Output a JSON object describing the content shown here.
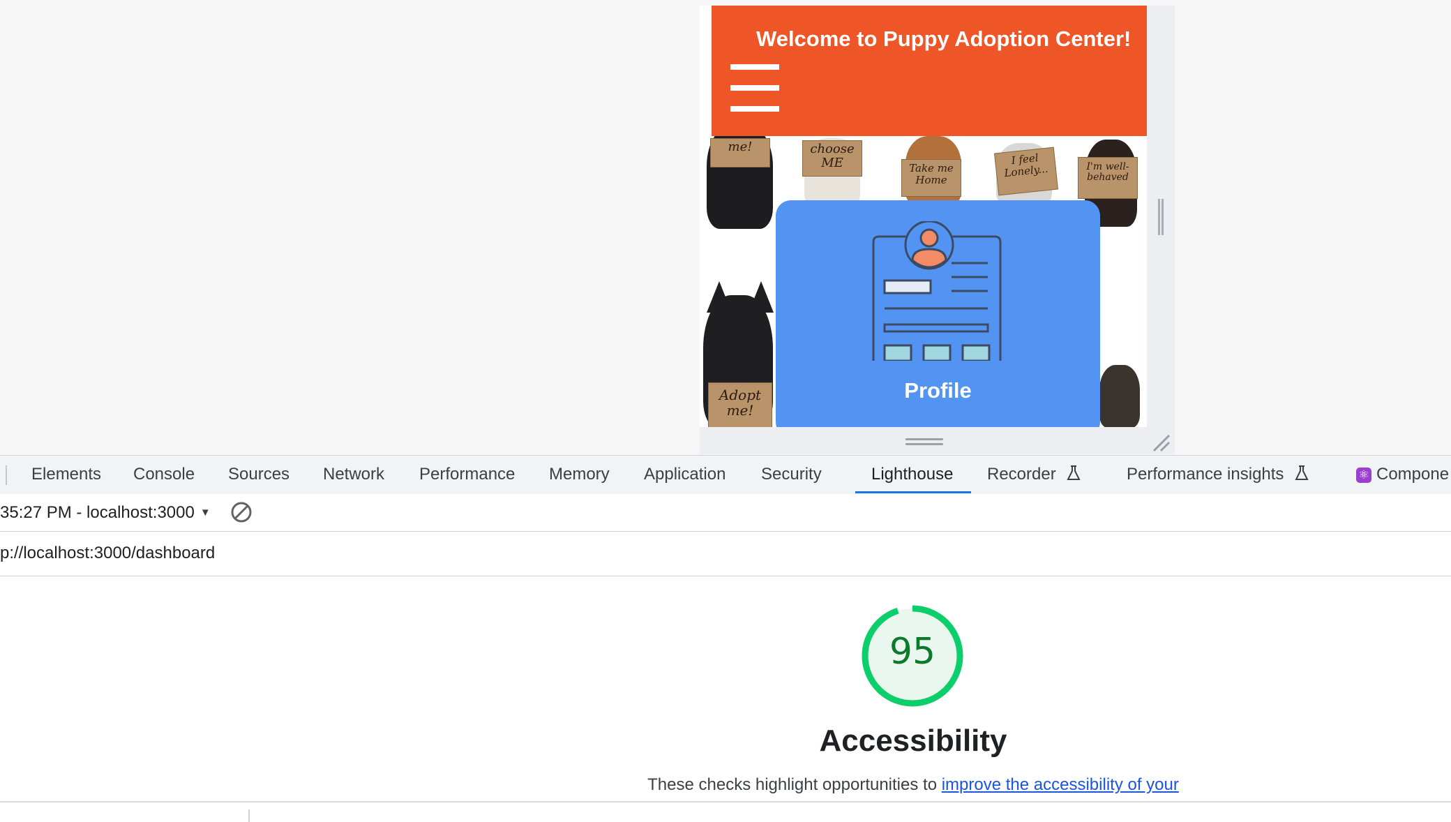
{
  "app": {
    "header_title": "Welcome to Puppy Adoption Center!",
    "profile_label": "Profile",
    "signs": [
      "me!",
      "choose ME",
      "Take me Home",
      "I feel Lonely...",
      "I'm well-behaved",
      "Adopt me!"
    ]
  },
  "devtools": {
    "tabs": [
      {
        "label": "Elements"
      },
      {
        "label": "Console"
      },
      {
        "label": "Sources"
      },
      {
        "label": "Network"
      },
      {
        "label": "Performance"
      },
      {
        "label": "Memory"
      },
      {
        "label": "Application"
      },
      {
        "label": "Security"
      },
      {
        "label": "Lighthouse",
        "active": true
      },
      {
        "label": "Recorder",
        "icon": "flask-icon"
      },
      {
        "label": "Performance insights",
        "icon": "flask-icon"
      },
      {
        "label": "Compone",
        "icon": "react-icon"
      }
    ],
    "report_select": "35:27 PM - localhost:3000",
    "url": "p://localhost:3000/dashboard"
  },
  "lighthouse": {
    "score": "95",
    "score_fraction": 0.95,
    "category": "Accessibility",
    "description_prefix": "These checks highlight opportunities to ",
    "description_link": "improve the accessibility of your",
    "colors": {
      "pass": "#0cce6b",
      "score_text": "#0c7a2c",
      "gauge_fill": "#e9f7ee"
    }
  },
  "colors": {
    "header": "#ee5527",
    "card": "#5394f2",
    "devtools_accent": "#1a73e8"
  }
}
